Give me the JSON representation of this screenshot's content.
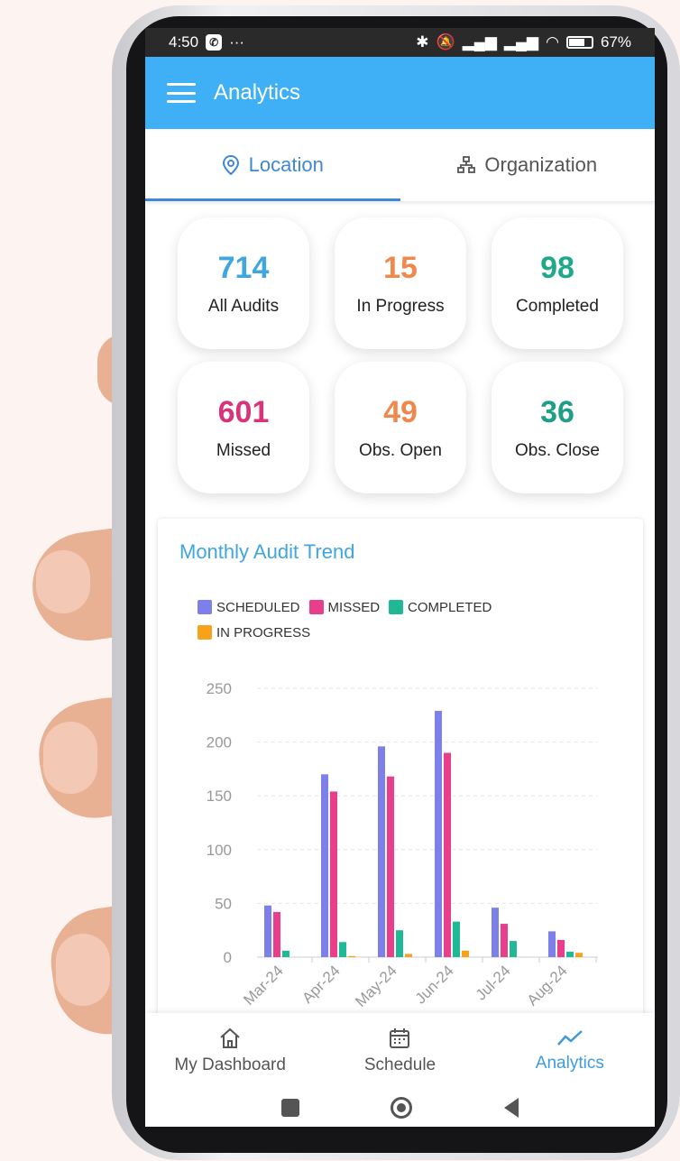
{
  "statusbar": {
    "time": "4:50",
    "dots": "···",
    "battery": "67%"
  },
  "appbar": {
    "title": "Analytics"
  },
  "tabs": [
    {
      "label": "Location",
      "icon": "location-pin-icon",
      "active": true
    },
    {
      "label": "Organization",
      "icon": "org-chart-icon",
      "active": false
    }
  ],
  "stats": [
    {
      "value": "714",
      "label": "All Audits",
      "color": "#3fa6df"
    },
    {
      "value": "15",
      "label": "In Progress",
      "color": "#f0884e"
    },
    {
      "value": "98",
      "label": "Completed",
      "color": "#1fa98a"
    },
    {
      "value": "601",
      "label": "Missed",
      "color": "#d9347a"
    },
    {
      "value": "49",
      "label": "Obs. Open",
      "color": "#f0884e"
    },
    {
      "value": "36",
      "label": "Obs. Close",
      "color": "#1f9e8a"
    }
  ],
  "chart": {
    "title": "Monthly Audit Trend"
  },
  "chart_data": {
    "type": "bar",
    "title": "Monthly Audit Trend",
    "categories": [
      "Mar-24",
      "Apr-24",
      "May-24",
      "Jun-24",
      "Jul-24",
      "Aug-24"
    ],
    "series": [
      {
        "name": "SCHEDULED",
        "color": "#7d80e8",
        "values": [
          48,
          170,
          196,
          229,
          46,
          24
        ]
      },
      {
        "name": "MISSED",
        "color": "#e83e8c",
        "values": [
          42,
          154,
          168,
          190,
          31,
          16
        ]
      },
      {
        "name": "COMPLETED",
        "color": "#20b998",
        "values": [
          6,
          14,
          25,
          33,
          15,
          5
        ]
      },
      {
        "name": "IN PROGRESS",
        "color": "#f7a21b",
        "values": [
          0,
          1,
          3,
          6,
          0,
          4
        ]
      }
    ],
    "yticks": [
      0,
      50,
      100,
      150,
      200,
      250
    ],
    "ylim": [
      0,
      250
    ],
    "grid": true,
    "legend": "top"
  },
  "bottomnav": [
    {
      "label": "My Dashboard",
      "icon": "home-icon",
      "active": false
    },
    {
      "label": "Schedule",
      "icon": "calendar-icon",
      "active": false
    },
    {
      "label": "Analytics",
      "icon": "trend-line-icon",
      "active": true
    }
  ]
}
